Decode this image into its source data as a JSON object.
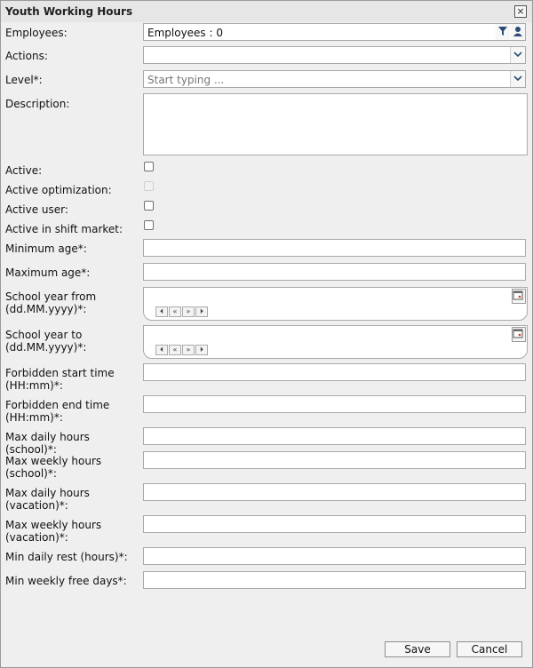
{
  "dialog": {
    "title": "Youth Working Hours",
    "close_symbol": "×"
  },
  "fields": {
    "employees": {
      "label": "Employees:",
      "value": "Employees : 0"
    },
    "actions": {
      "label": "Actions:",
      "value": ""
    },
    "level": {
      "label": "Level*:",
      "placeholder": "Start typing ..."
    },
    "description": {
      "label": "Description:",
      "value": ""
    },
    "active": {
      "label": "Active:",
      "checked": false
    },
    "active_optimization": {
      "label": "Active optimization:",
      "checked": false,
      "disabled": true
    },
    "active_user": {
      "label": "Active user:",
      "checked": false
    },
    "active_shift_market": {
      "label": "Active in shift market:",
      "checked": false
    },
    "minimum_age": {
      "label": "Minimum age*:",
      "value": ""
    },
    "maximum_age": {
      "label": "Maximum age*:",
      "value": ""
    },
    "school_year_from": {
      "label_line1": "School year from",
      "label_line2": "(dd.MM.yyyy)*:",
      "value": ""
    },
    "school_year_to": {
      "label_line1": "School year to",
      "label_line2": "(dd.MM.yyyy)*:",
      "value": ""
    },
    "forbidden_start": {
      "label_line1": "Forbidden start time",
      "label_line2": "(HH:mm)*:",
      "value": ""
    },
    "forbidden_end": {
      "label_line1": "Forbidden end time",
      "label_line2": "(HH:mm)*:",
      "value": ""
    },
    "max_daily_school": {
      "label": "Max daily hours (school)*:",
      "value": ""
    },
    "max_weekly_school": {
      "label_line1": "Max weekly hours",
      "label_line2": "(school)*:",
      "value": ""
    },
    "max_daily_vacation": {
      "label_line1": "Max daily hours",
      "label_line2": "(vacation)*:",
      "value": ""
    },
    "max_weekly_vacation": {
      "label_line1": "Max weekly hours",
      "label_line2": "(vacation)*:",
      "value": ""
    },
    "min_daily_rest": {
      "label": "Min daily rest (hours)*:",
      "value": ""
    },
    "min_weekly_free_days": {
      "label": "Min weekly free days*:",
      "value": ""
    }
  },
  "date_nav": {
    "first": "⏴",
    "prev": "«",
    "next": "»",
    "last": "⏵"
  },
  "footer": {
    "save_label": "Save",
    "cancel_label": "Cancel"
  },
  "icons": [
    "close-icon",
    "filter-icon",
    "user-icon",
    "chevron-down-icon",
    "calendar-icon"
  ],
  "colors": {
    "border": "#a9a9a9",
    "background": "#efefef"
  }
}
